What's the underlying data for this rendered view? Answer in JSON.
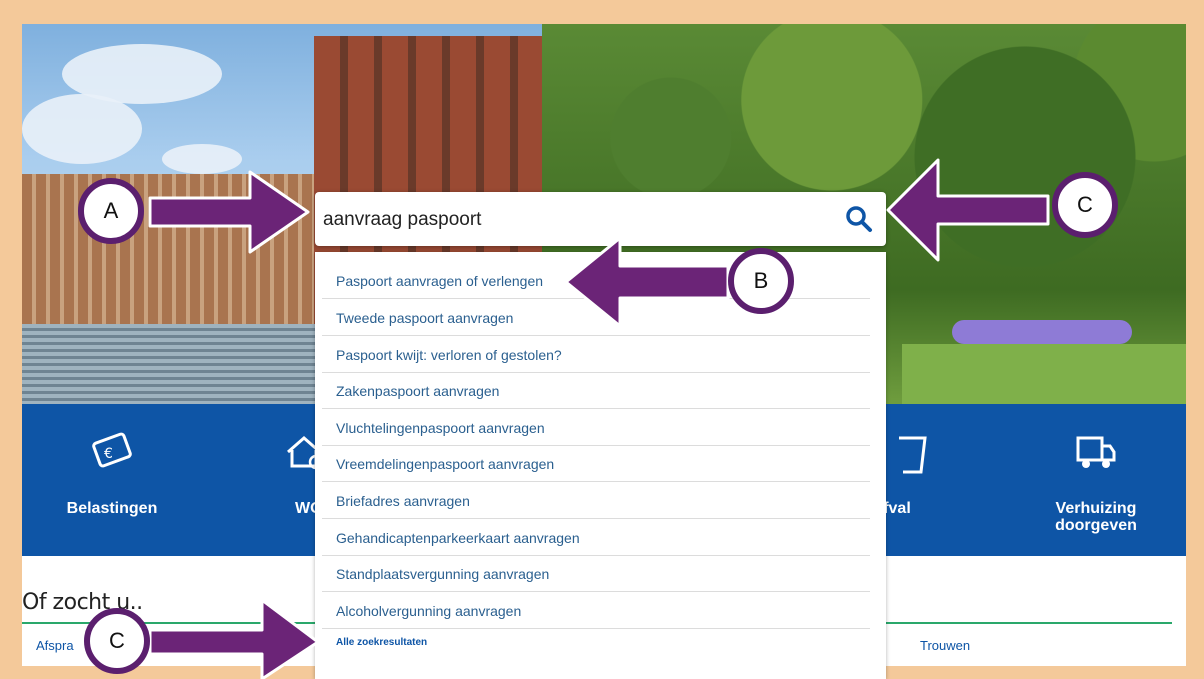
{
  "search": {
    "value": "aanvraag paspoort",
    "suggestions": [
      "Paspoort aanvragen of verlengen",
      "Tweede paspoort aanvragen",
      "Paspoort kwijt: verloren of gestolen?",
      "Zakenpaspoort aanvragen",
      "Vluchtelingenpaspoort aanvragen",
      "Vreemdelingenpaspoort aanvragen",
      "Briefadres aanvragen",
      "Gehandicaptenparkeerkaart aanvragen",
      "Standplaatsvergunning aanvragen",
      "Alcoholvergunning aanvragen"
    ],
    "all_results_label": "Alle zoekresultaten"
  },
  "tiles": {
    "belastingen": "Belastingen",
    "woz": "WOZ-wa",
    "afval": "fval",
    "verhuizing_line1": "Verhuizing",
    "verhuizing_line2": "doorgeven"
  },
  "bottom": {
    "heading": "Of zocht u..",
    "link_left": "Afspra",
    "link_right": "Trouwen"
  },
  "callouts": {
    "a": "A",
    "b": "B",
    "c": "C"
  },
  "colors": {
    "frame": "#f4c99a",
    "band": "#0e55a6",
    "annotation": "#6b2477",
    "accent_line": "#2aa86b"
  }
}
